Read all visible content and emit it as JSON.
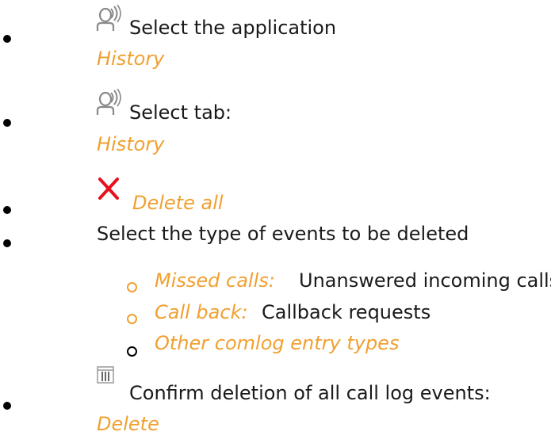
{
  "steps": [
    {
      "icon": "user-radio-icon",
      "text": "Select the application",
      "link": "History"
    },
    {
      "icon": "user-radio-icon",
      "text": "Select tab:",
      "link": "History"
    },
    {
      "icon": "close-x-icon",
      "link": "Delete all"
    },
    {
      "text": "Select the type of events to be deleted",
      "options": [
        {
          "label": "Missed calls:",
          "description": "Unanswered incoming calls",
          "marker_color": "#f0a030"
        },
        {
          "label": "Call back:",
          "description": "Callback requests",
          "marker_color": "#f0a030"
        },
        {
          "label": "Other comlog entry types",
          "description": "",
          "marker_color": "#000000"
        }
      ]
    },
    {
      "icon": "trash-grid-icon",
      "text": "Confirm deletion of all call log events:",
      "link": "Delete"
    }
  ],
  "colors": {
    "accent": "#f0a030",
    "x_icon": "#e8101c",
    "icon_gray": "#8a8a8a"
  }
}
